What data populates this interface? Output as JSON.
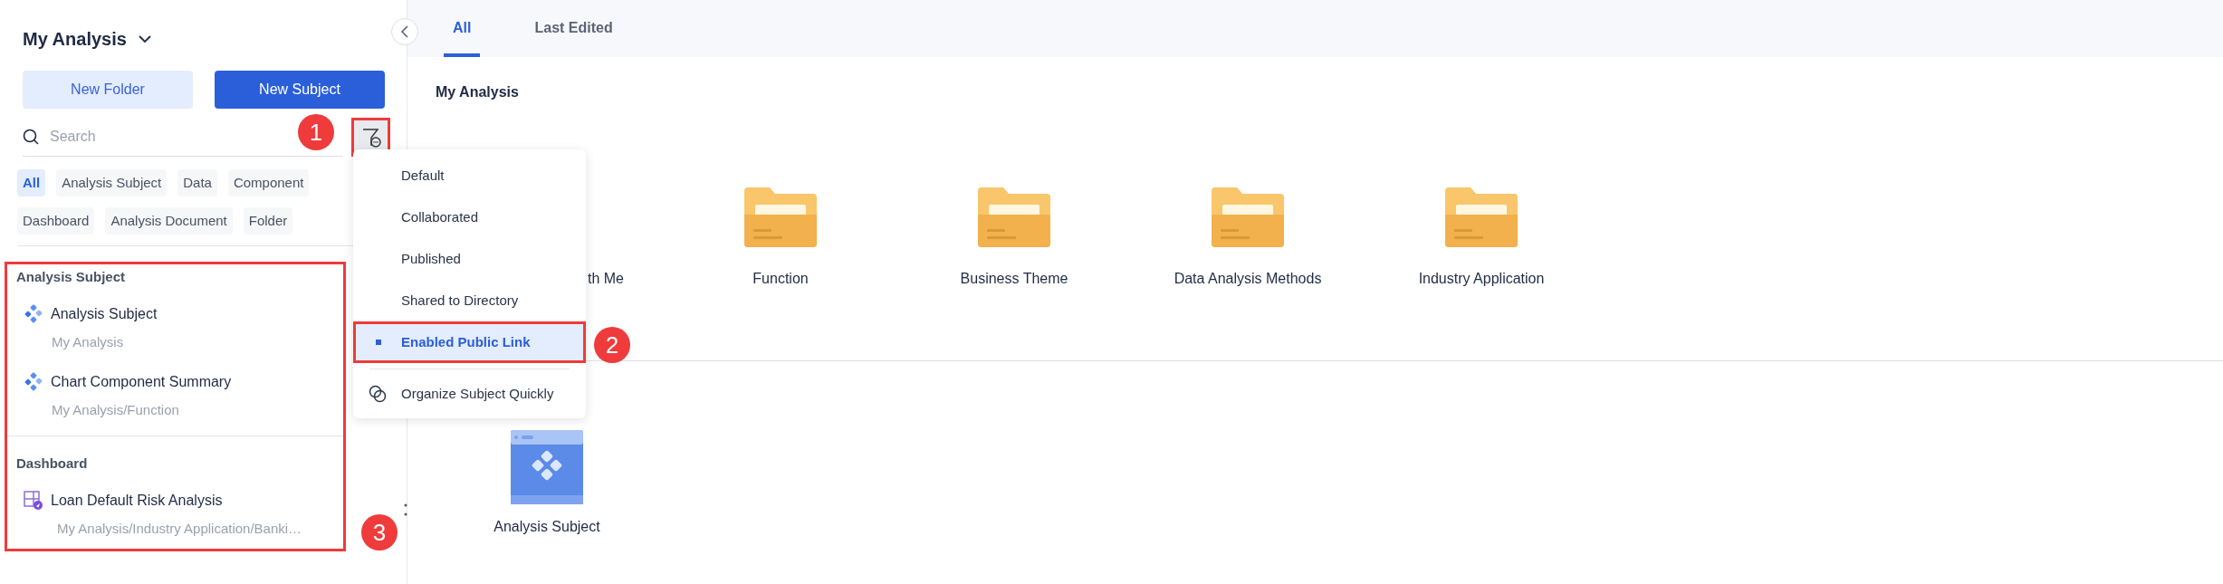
{
  "sidebar": {
    "title": "My Analysis",
    "buttons": [
      {
        "label": "New Folder",
        "kind": "secondary"
      },
      {
        "label": "New Subject",
        "kind": "primary"
      }
    ],
    "search": {
      "placeholder": "Search"
    },
    "type_filters": [
      {
        "label": "All",
        "selected": true
      },
      {
        "label": "Analysis Subject",
        "selected": false
      },
      {
        "label": "Data",
        "selected": false
      },
      {
        "label": "Component",
        "selected": false
      },
      {
        "label": "Dashboard",
        "selected": false
      },
      {
        "label": "Analysis Document",
        "selected": false
      },
      {
        "label": "Folder",
        "selected": false
      }
    ],
    "groups": [
      {
        "title": "Analysis Subject",
        "items": [
          {
            "kind": "subject",
            "name": "Analysis Subject",
            "path": "My Analysis"
          },
          {
            "kind": "subject",
            "name": "Chart Component Summary",
            "path": "My Analysis/Function"
          }
        ]
      },
      {
        "title": "Dashboard",
        "items": [
          {
            "kind": "dashboard",
            "name": "Loan Default Risk Analysis",
            "path": "My Analysis/Industry Application/Banki…"
          }
        ]
      }
    ]
  },
  "filter_menu": {
    "options": [
      {
        "label": "Default",
        "selected": false
      },
      {
        "label": "Collaborated",
        "selected": false
      },
      {
        "label": "Published",
        "selected": false
      },
      {
        "label": "Shared to Directory",
        "selected": false
      },
      {
        "label": "Enabled Public Link",
        "selected": true
      }
    ],
    "action": "Organize Subject Quickly"
  },
  "tabs": [
    {
      "label": "All",
      "selected": true
    },
    {
      "label": "Last Edited",
      "selected": false
    }
  ],
  "main": {
    "section_title": "My Analysis",
    "folders": [
      {
        "kind": "covered",
        "label": "th Me"
      },
      {
        "kind": "folder",
        "label": "Function"
      },
      {
        "kind": "folder",
        "label": "Business Theme"
      },
      {
        "kind": "folder",
        "label": "Data Analysis Methods"
      },
      {
        "kind": "folder",
        "label": "Industry Application"
      }
    ],
    "subjects": [
      {
        "name": "Analysis Subject"
      }
    ]
  },
  "annotations": [
    {
      "label": "1"
    },
    {
      "label": "2"
    },
    {
      "label": "3"
    }
  ]
}
